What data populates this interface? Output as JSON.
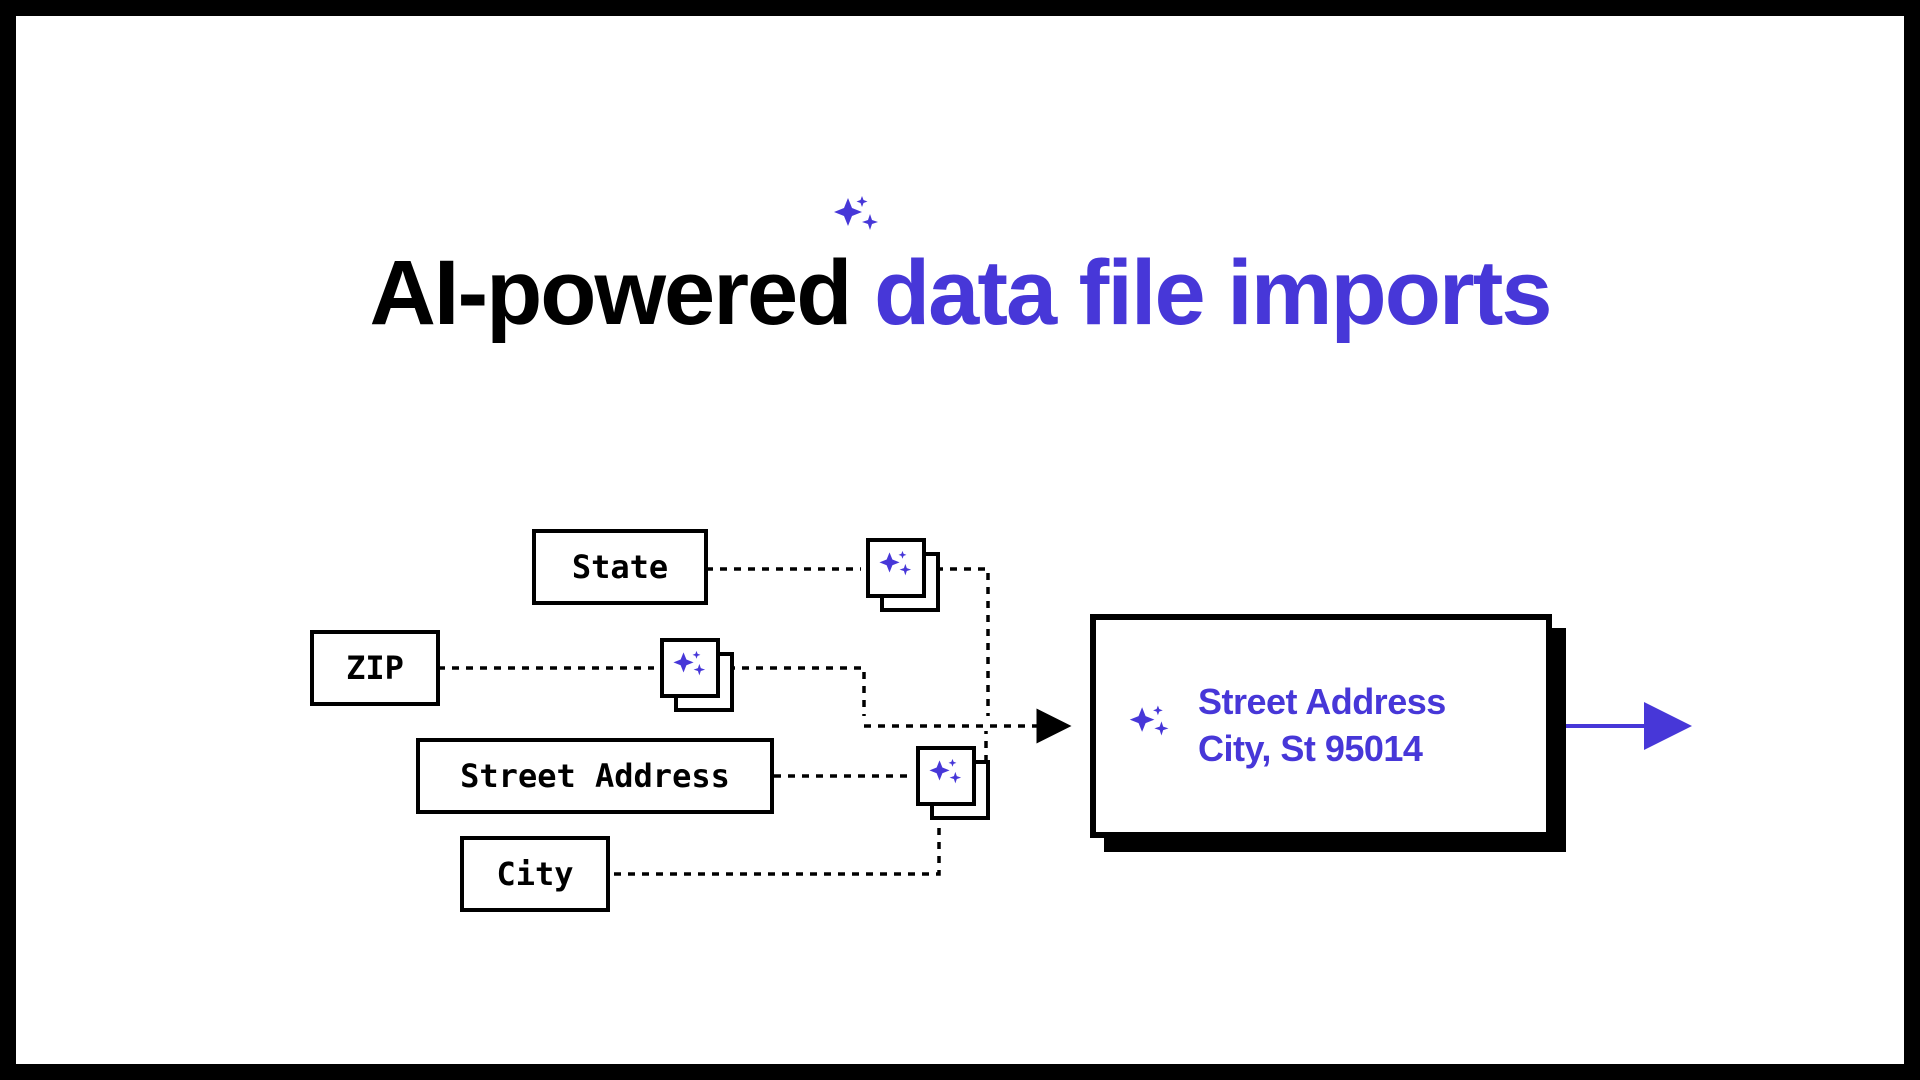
{
  "title": {
    "part1": "AI-powered ",
    "part2": "data file imports"
  },
  "inputs": {
    "state": "State",
    "zip": "ZIP",
    "street": "Street Address",
    "city": "City"
  },
  "output": {
    "line1": "Street Address",
    "line2": "City, St 95014"
  },
  "colors": {
    "accent": "#4737d8"
  }
}
